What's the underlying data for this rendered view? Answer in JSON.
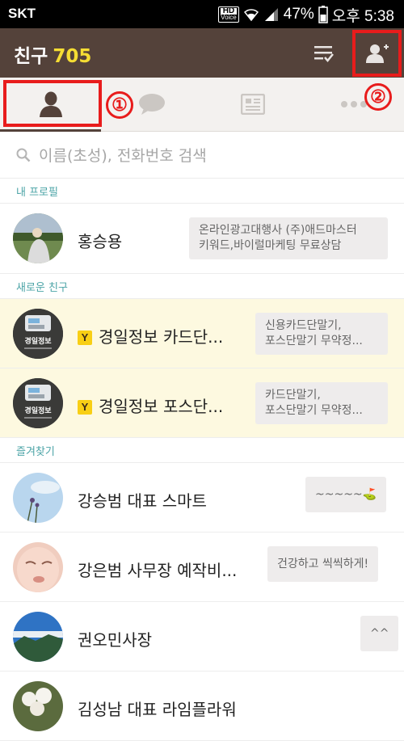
{
  "status_bar": {
    "carrier": "SKT",
    "hd_label": "HD",
    "voice_label": "Voice",
    "battery": "47%",
    "time": "오후 5:38"
  },
  "header": {
    "title": "친구",
    "count": "705"
  },
  "annotations": {
    "callout_1": "①",
    "callout_2": "②"
  },
  "search": {
    "placeholder": "이름(초성), 전화번호 검색"
  },
  "sections": {
    "my_profile": "내 프로필",
    "new_friends": "새로운 친구",
    "favorites": "즐겨찾기"
  },
  "my_profile": {
    "name": "홍승용",
    "status_line1": "온라인광고대행사 (주)애드마스터",
    "status_line2": "키워드,바이럴마케팅 무료상담"
  },
  "new_friends": [
    {
      "badge": "Y",
      "name": "경일정보 카드단...",
      "status_line1": "신용카드단말기,",
      "status_line2": "포스단말기 무약정...",
      "avatar_text": "경일정보"
    },
    {
      "badge": "Y",
      "name": "경일정보 포스단...",
      "status_line1": "카드단말기,",
      "status_line2": "포스단말기 무약정...",
      "avatar_text": "경일정보"
    }
  ],
  "favorites": [
    {
      "name": "강승범 대표 스마트",
      "status": "~~~~~⛳"
    },
    {
      "name": "강은범 사무장 예작비...",
      "status": "건강하고 씩씩하게!"
    },
    {
      "name": "권오민사장",
      "status": "^^"
    },
    {
      "name": "김성남 대표 라임플라워",
      "status": ""
    }
  ],
  "colors": {
    "header_bg": "#54423a",
    "count_yellow": "#f5dd33",
    "section_label": "#4aa3a6",
    "new_friend_bg": "#fdf9e0",
    "annotation_red": "#e81c1c"
  }
}
